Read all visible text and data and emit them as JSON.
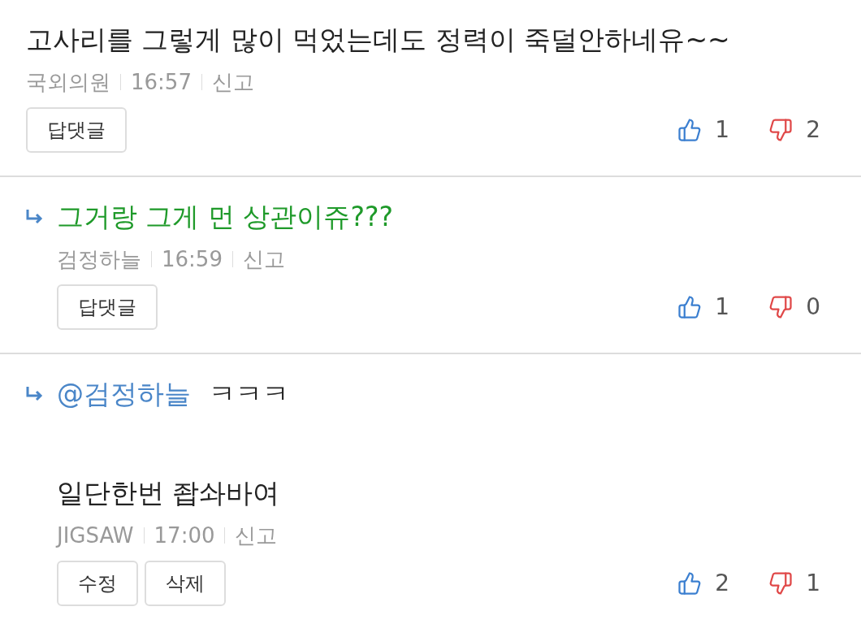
{
  "comments": [
    {
      "kind": "top",
      "text": "고사리를 그렇게 많이 먹었는데도 정력이 죽덜안하네유~~",
      "color": "#222222",
      "author": "국외의원",
      "time": "16:57",
      "report": "신고",
      "buttons": [
        "답댓글"
      ],
      "up": "1",
      "down": "2"
    },
    {
      "kind": "reply",
      "text": "그거랑 그게 먼 상관이쥬???",
      "color": "#1f9a2a",
      "author": "검정하늘",
      "time": "16:59",
      "report": "신고",
      "buttons": [
        "답댓글"
      ],
      "up": "1",
      "down": "0"
    },
    {
      "kind": "reply",
      "mention": "@검정하늘",
      "text": "ㅋㅋㅋ",
      "color": "#222222",
      "extra_text": "일단한번 좝솨바여",
      "author": "JIGSAW",
      "time": "17:00",
      "report": "신고",
      "buttons": [
        "수정",
        "삭제"
      ],
      "up": "2",
      "down": "1"
    }
  ]
}
